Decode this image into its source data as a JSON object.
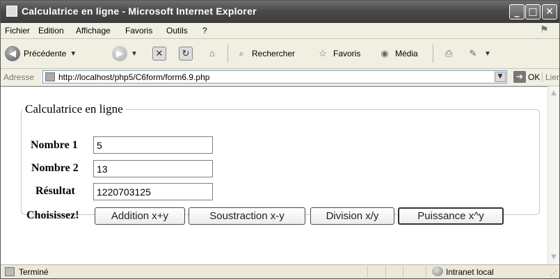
{
  "window": {
    "title": "Calculatrice en ligne - Microsoft Internet Explorer",
    "minimize": "_",
    "maximize": "□",
    "close": "✕"
  },
  "menu": [
    "Fichier",
    "Edition",
    "Affichage",
    "Favoris",
    "Outils",
    "?"
  ],
  "toolbar": {
    "back_label": "Précédente",
    "search_label": "Rechercher",
    "favorites_label": "Favoris",
    "media_label": "Média"
  },
  "address": {
    "label": "Adresse",
    "url": "http://localhost/php5/C6form/form6.9.php",
    "go_label": "OK",
    "links_label": "Liens"
  },
  "form": {
    "legend": "Calculatrice en ligne",
    "number1_label": "Nombre 1",
    "number1_value": "5",
    "number2_label": "Nombre 2",
    "number2_value": "13",
    "result_label": "Résultat",
    "result_value": "1220703125",
    "choose_label": "Choisissez!",
    "buttons": [
      "Addition x+y",
      "Soustraction x-y",
      "Division x/y",
      "Puissance x^y"
    ]
  },
  "status": {
    "text": "Terminé",
    "zone": "Intranet local"
  },
  "icons": {
    "back": "arrow-left-icon",
    "forward": "arrow-right-icon",
    "stop": "stop-icon",
    "refresh": "refresh-icon",
    "home": "home-icon",
    "search": "search-icon",
    "favorites": "star-icon",
    "media": "media-icon",
    "print": "print-icon",
    "edit": "edit-icon"
  }
}
